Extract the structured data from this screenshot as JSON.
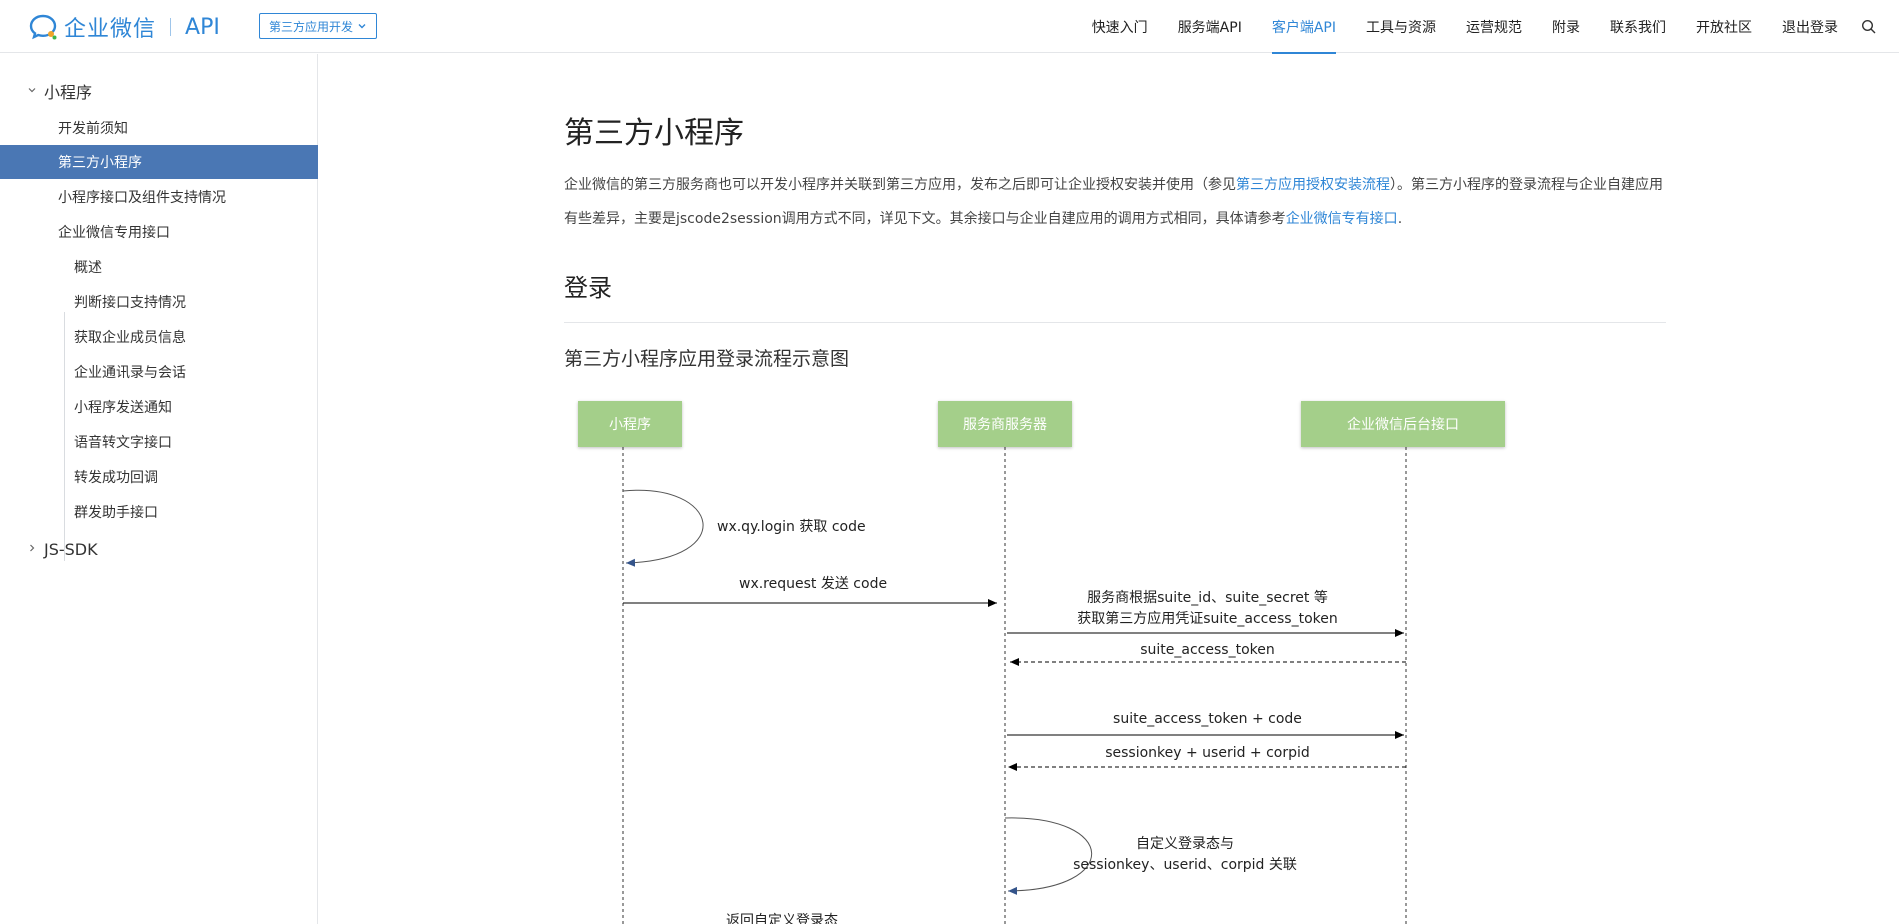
{
  "header": {
    "logo_name": "企业微信",
    "logo_api": "API",
    "dev_select": "第三方应用开发",
    "nav": [
      "快速入门",
      "服务端API",
      "客户端API",
      "工具与资源",
      "运营规范",
      "附录",
      "联系我们",
      "开放社区",
      "退出登录"
    ],
    "active_nav": "客户端API"
  },
  "sidebar": {
    "group1": "小程序",
    "items": [
      "开发前须知",
      "第三方小程序",
      "小程序接口及组件支持情况",
      "企业微信专用接口"
    ],
    "sub_items": [
      "概述",
      "判断接口支持情况",
      "获取企业成员信息",
      "企业通讯录与会话",
      "小程序发送通知",
      "语音转文字接口",
      "转发成功回调",
      "群发助手接口"
    ],
    "group2": "JS-SDK"
  },
  "content": {
    "title": "第三方小程序",
    "intro_1": "企业微信的第三方服务商也可以开发小程序并关联到第三方应用，发布之后即可让企业授权安装并使用（参见",
    "intro_link_1": "第三方应用授权安装流程",
    "intro_2": "）。第三方小程序的登录流程与企业自建应用有些差异，主要是jscode2session调用方式不同，详见下文。其余接口与企业自建应用的调用方式相同，具体请参考",
    "intro_link_2": "企业微信专有接口",
    "intro_3": ".",
    "h2": "登录",
    "h3": "第三方小程序应用登录流程示意图"
  },
  "diagram": {
    "actors": [
      "小程序",
      "服务商服务器",
      "企业微信后台接口"
    ],
    "messages": {
      "m1": "wx.qy.login 获取 code",
      "m2": "wx.request 发送 code",
      "m3a": "服务商根据suite_id、suite_secret 等",
      "m3b": "获取第三方应用凭证suite_access_token",
      "m4": "suite_access_token",
      "m5": "suite_access_token + code",
      "m6": "sessionkey + userid + corpid",
      "m7a": "自定义登录态与",
      "m7b": "sessionkey、userid、corpid 关联",
      "m8": "返回自定义登录态"
    },
    "actor_color": "#a4cf8a"
  }
}
